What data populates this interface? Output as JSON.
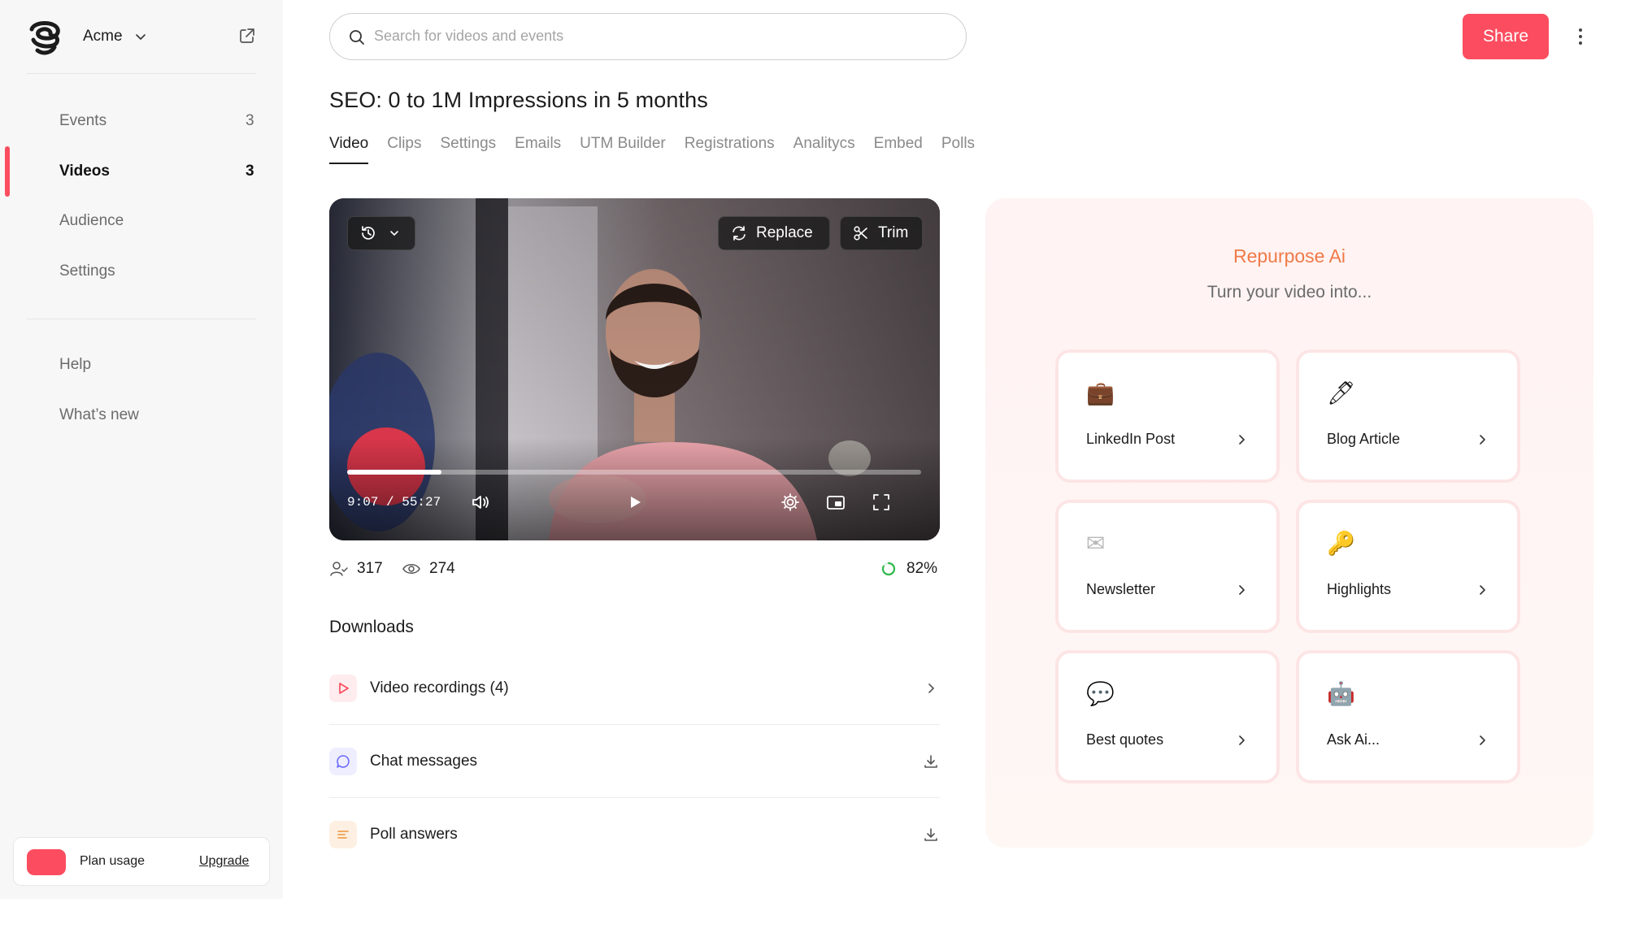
{
  "sidebar": {
    "workspace_name": "Acme",
    "nav_items": [
      {
        "label": "Events",
        "count": "3"
      },
      {
        "label": "Videos",
        "count": "3"
      },
      {
        "label": "Audience"
      },
      {
        "label": "Settings"
      }
    ],
    "secondary_items": [
      {
        "label": "Help"
      },
      {
        "label": "What’s new"
      }
    ],
    "plan": {
      "label": "Plan usage",
      "upgrade": "Upgrade"
    }
  },
  "header": {
    "search_placeholder": "Search for videos and events",
    "share_label": "Share"
  },
  "page": {
    "title": "SEO: 0 to 1M Impressions in 5 months",
    "tabs": [
      "Video",
      "Clips",
      "Settings",
      "Emails",
      "UTM Builder",
      "Registrations",
      "Analitycs",
      "Embed",
      "Polls"
    ],
    "active_tab": "Video"
  },
  "player": {
    "replace_label": "Replace",
    "trim_label": "Trim",
    "current_time": "9:07",
    "duration": "55:27",
    "progress_fraction": 0.164
  },
  "stats": {
    "registrants": "317",
    "views": "274",
    "completion": "82%"
  },
  "downloads": {
    "title": "Downloads",
    "items": [
      {
        "label": "Video recordings (4)",
        "icon": "play-icon",
        "action": "chevron-right-icon",
        "accent": "#fb4d5f"
      },
      {
        "label": "Chat messages",
        "icon": "chat-bubble-icon",
        "action": "download-icon",
        "accent": "#6b6bff"
      },
      {
        "label": "Poll answers",
        "icon": "poll-lines-icon",
        "action": "download-icon",
        "accent": "#f0a050"
      }
    ]
  },
  "repurpose": {
    "title": "Repurpose Ai",
    "subtitle": "Turn your video into...",
    "cards": [
      {
        "label": "LinkedIn Post",
        "emoji": "💼",
        "icon": "briefcase-icon"
      },
      {
        "label": "Blog Article",
        "emoji": "🖊",
        "icon": "pen-icon"
      },
      {
        "label": "Newsletter",
        "emoji": "✉",
        "icon": "envelope-icon"
      },
      {
        "label": "Highlights",
        "emoji": "🔑",
        "icon": "key-icon"
      },
      {
        "label": "Best quotes",
        "emoji": "💬",
        "icon": "speech-bubble-icon"
      },
      {
        "label": "Ask Ai...",
        "emoji": "🤖",
        "icon": "robot-icon"
      }
    ]
  },
  "colors": {
    "accent": "#fb4d5f",
    "repurpose_title": "#f07a48",
    "progress_ring": "#2fb84a"
  }
}
